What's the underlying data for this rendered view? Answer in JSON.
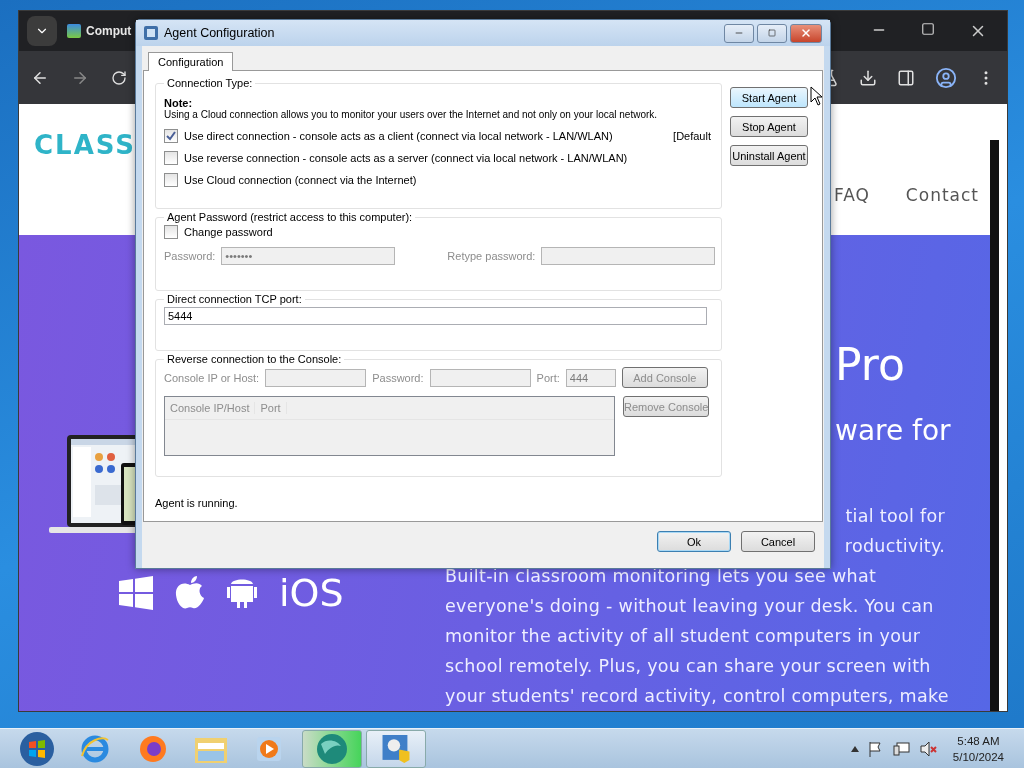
{
  "browser": {
    "tab_title": "Comput",
    "site": {
      "logo": "CLASS",
      "nav": [
        "FAQ",
        "Contact"
      ]
    },
    "hero": {
      "heading": "Pro",
      "subheading": "ware for",
      "platform_label": "iOS",
      "partial_lines": [
        "tial tool for",
        "roductivity."
      ],
      "lines": [
        "Built-in classroom monitoring lets you see what",
        "everyone's doing - without leaving your desk. You can",
        "monitor the activity of all student computers in your",
        "school remotely. Plus, you can share your screen with",
        "your students' record activity, control computers, make"
      ]
    }
  },
  "dialog": {
    "title": "Agent Configuration",
    "tabs": [
      {
        "label": "Configuration",
        "selected": true
      }
    ],
    "connection": {
      "legend": "Connection Type:",
      "note_title": "Note:",
      "note": "Using a Cloud connection allows you to monitor your users over the Internet and not only on your local network.",
      "options": [
        {
          "label": "Use direct connection - console acts as a client (connect via local network - LAN/WLAN)",
          "checked": true,
          "tag": "[Default"
        },
        {
          "label": "Use reverse connection - console acts as a server (connect via local network - LAN/WLAN)",
          "checked": false
        },
        {
          "label": "Use Cloud connection (connect via the Internet)",
          "checked": false
        }
      ]
    },
    "password": {
      "legend": "Agent Password (restrict access to this computer):",
      "change": {
        "label": "Change password",
        "checked": false
      },
      "disabled": true,
      "password_label": "Password:",
      "password_value": "•••••••",
      "retype_label": "Retype password:"
    },
    "tcp": {
      "legend": "Direct connection TCP port:",
      "value": "5444"
    },
    "reverse": {
      "legend": "Reverse connection to the Console:",
      "disabled": true,
      "host_label": "Console IP or Host:",
      "password_label": "Password:",
      "port_label": "Port:",
      "port_value": "444",
      "columns": [
        "Console IP/Host",
        "Port"
      ],
      "buttons": [
        {
          "label": "Add Console",
          "disabled": true
        },
        {
          "label": "Remove Console",
          "disabled": true
        }
      ]
    },
    "status": "Agent is running.",
    "side_buttons": [
      {
        "label": "Start Agent",
        "highlighted": true
      },
      {
        "label": "Stop Agent",
        "highlighted": false
      },
      {
        "label": "Uninstall Agent",
        "highlighted": false
      }
    ],
    "footer_buttons": [
      {
        "label": "Ok",
        "default": true
      },
      {
        "label": "Cancel",
        "default": false
      }
    ]
  },
  "taskbar": {
    "running_apps": [
      {
        "selected": true
      },
      {
        "selected": false
      }
    ],
    "clock": {
      "time": "5:48 AM",
      "date": "5/10/2024"
    }
  }
}
